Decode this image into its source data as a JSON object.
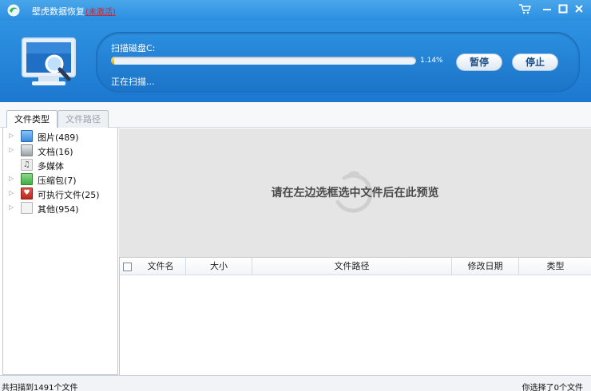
{
  "window": {
    "title": "壁虎数据恢复",
    "badge": "(未激活)",
    "controls": [
      "cart-icon",
      "minimize-icon",
      "maximize-icon",
      "close-icon"
    ]
  },
  "scan": {
    "title": "扫描磁盘C:",
    "progress": 0.0114,
    "progress_label": "1.14%",
    "status": "正在扫描...",
    "pause_label": "暂停",
    "stop_label": "停止"
  },
  "tabs": [
    {
      "label": "文件类型",
      "active": true
    },
    {
      "label": "文件路径",
      "active": false
    }
  ],
  "tree": [
    {
      "label": "图片(489)",
      "icon": "image-icon",
      "color": "#3a8be0",
      "has_arrow": true
    },
    {
      "label": "文档(16)",
      "icon": "document-icon",
      "color": "#9aa0a6",
      "has_arrow": true
    },
    {
      "label": "多媒体",
      "icon": "music-icon",
      "color": "#d9d9d9",
      "has_arrow": false
    },
    {
      "label": "压缩包(7)",
      "icon": "archive-icon",
      "color": "#3fae3f",
      "has_arrow": true
    },
    {
      "label": "可执行文件(25)",
      "icon": "executable-icon",
      "color": "#b8281f",
      "has_arrow": true
    },
    {
      "label": "其他(954)",
      "icon": "other-file-icon",
      "color": "#e6e6e6",
      "has_arrow": true
    }
  ],
  "preview": {
    "hint": "请在左边选框选中文件后在此预览"
  },
  "table": {
    "columns": [
      "文件名",
      "大小",
      "文件路径",
      "修改日期",
      "类型"
    ]
  },
  "status": {
    "left": "共扫描到1491个文件",
    "right": "你选择了0个文件"
  },
  "colors": {
    "titlebar": "#2a8ee0",
    "header": "#1f7dd4",
    "progress": "#e0b12a"
  }
}
